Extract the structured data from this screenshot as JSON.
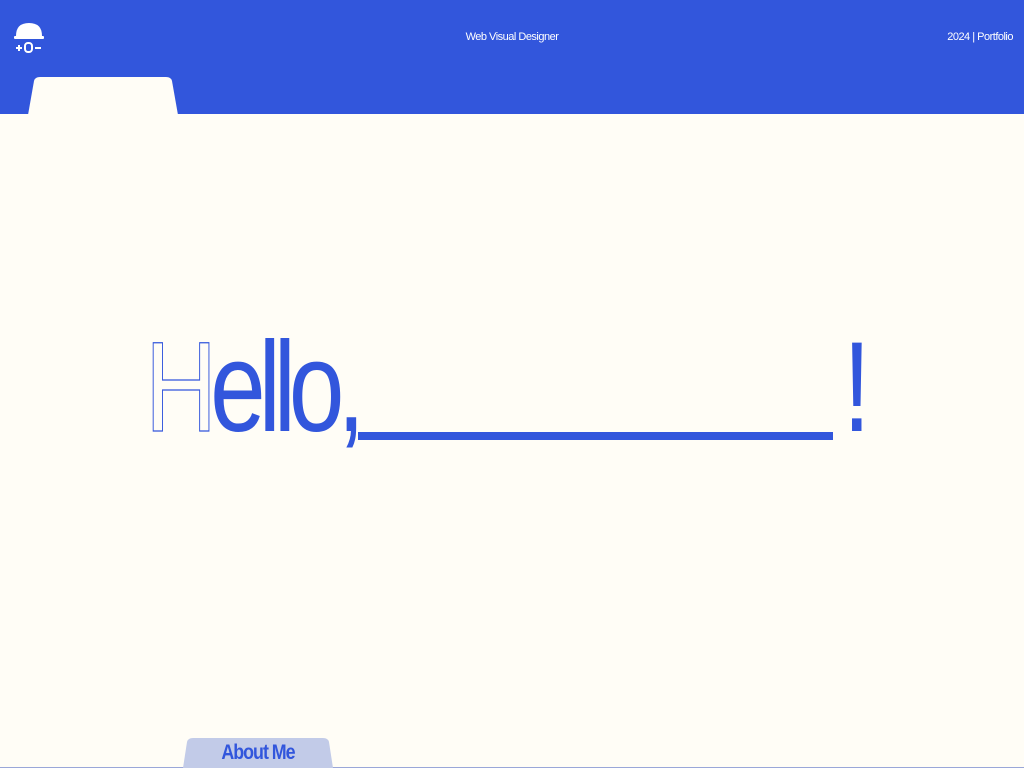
{
  "header": {
    "logo_icon": "hardhat-logo-icon",
    "center_text": "Web Visual Designer",
    "right_text": "2024 | Portfolio"
  },
  "hero": {
    "first_letter": "H",
    "rest": "ello,",
    "exclamation": "!"
  },
  "footer_tab": {
    "label": "About Me"
  },
  "colors": {
    "brand_blue": "#3256dc",
    "background": "#fffdf6",
    "tab_light": "#c2cbe8"
  }
}
